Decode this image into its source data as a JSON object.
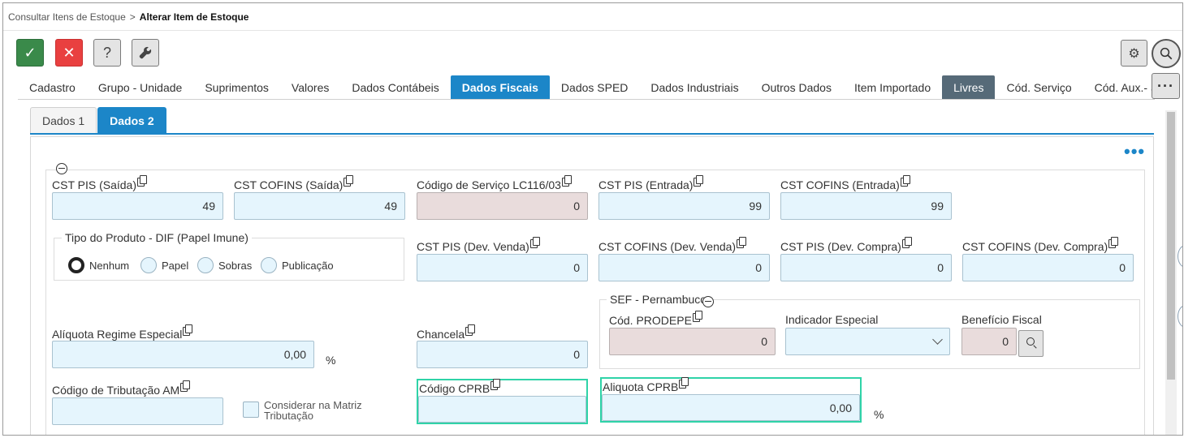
{
  "breadcrumb": {
    "parent": "Consultar Itens de Estoque",
    "separator": ">",
    "current": "Alterar Item de Estoque"
  },
  "toolbar": {
    "ok_glyph": "✓",
    "cancel_glyph": "✕",
    "help_glyph": "?",
    "tools_glyph": "🔧",
    "gear_glyph": "⚙",
    "more_glyph": "···"
  },
  "tabs": [
    {
      "label": "Cadastro"
    },
    {
      "label": "Grupo - Unidade"
    },
    {
      "label": "Suprimentos"
    },
    {
      "label": "Valores"
    },
    {
      "label": "Dados Contábeis"
    },
    {
      "label": "Dados Fiscais",
      "active": true
    },
    {
      "label": "Dados SPED"
    },
    {
      "label": "Dados Industriais"
    },
    {
      "label": "Outros Dados"
    },
    {
      "label": "Item Importado"
    },
    {
      "label": "Livres"
    },
    {
      "label": "Cód. Serviço"
    },
    {
      "label": "Cód. Aux.- Sinô"
    }
  ],
  "subtabs": [
    {
      "label": "Dados 1"
    },
    {
      "label": "Dados 2",
      "active": true
    }
  ],
  "panel_more": "•••",
  "fields": {
    "cst_pis_saida": {
      "label": "CST PIS (Saída)",
      "value": "49"
    },
    "cst_cofins_saida": {
      "label": "CST COFINS (Saída)",
      "value": "49"
    },
    "codigo_servico": {
      "label": "Código de Serviço LC116/03",
      "value": "0"
    },
    "cst_pis_entrada": {
      "label": "CST PIS (Entrada)",
      "value": "99"
    },
    "cst_cofins_entrada": {
      "label": "CST COFINS (Entrada)",
      "value": "99"
    },
    "cst_pis_dev_venda": {
      "label": "CST PIS (Dev. Venda)",
      "value": "0"
    },
    "cst_cofins_dev_venda": {
      "label": "CST COFINS (Dev. Venda)",
      "value": "0"
    },
    "cst_pis_dev_compra": {
      "label": "CST PIS (Dev. Compra)",
      "value": "0"
    },
    "cst_cofins_dev_compra": {
      "label": "CST COFINS (Dev. Compra)",
      "value": "0"
    },
    "aliquota_regime": {
      "label": "Alíquota Regime Especial",
      "value": "0,00",
      "unit": "%"
    },
    "chancela": {
      "label": "Chancela",
      "value": "0"
    },
    "codigo_tributacao_am": {
      "label": "Código de Tributação AM",
      "value": ""
    },
    "codigo_cprb": {
      "label": "Código CPRB",
      "value": ""
    },
    "aliquota_cprb": {
      "label": "Aliquota CPRB",
      "value": "0,00",
      "unit": "%"
    }
  },
  "tipo_produto": {
    "legend": "Tipo do Produto - DIF (Papel Imune)",
    "options": [
      {
        "label": "Nenhum",
        "selected": true
      },
      {
        "label": "Papel"
      },
      {
        "label": "Sobras"
      },
      {
        "label": "Publicação"
      }
    ]
  },
  "considerar_matriz": {
    "label": "Considerar na Matriz Tributação",
    "checked": false
  },
  "sef": {
    "legend": "SEF - Pernambuco",
    "cod_prodepe": {
      "label": "Cód. PRODEPE",
      "value": "0"
    },
    "indicador_especial": {
      "label": "Indicador Especial",
      "value": ""
    },
    "beneficio_fiscal": {
      "label": "Benefício Fiscal",
      "value": "0"
    }
  }
}
